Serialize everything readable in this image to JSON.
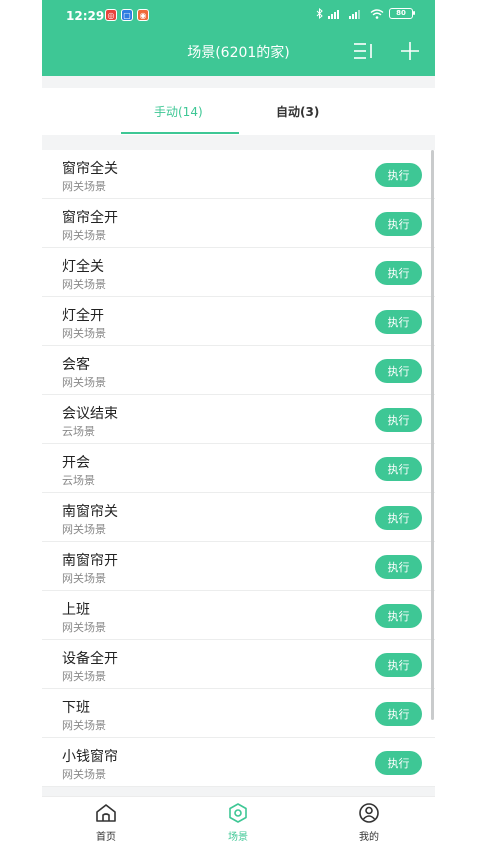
{
  "status_bar": {
    "time": "12:29",
    "battery": "80"
  },
  "header": {
    "title": "场景(6201的家)"
  },
  "tabs": [
    {
      "label": "手动(14)",
      "active": true
    },
    {
      "label": "自动(3)",
      "active": false
    }
  ],
  "scenes": [
    {
      "name": "窗帘全关",
      "type": "网关场景",
      "action": "执行"
    },
    {
      "name": "窗帘全开",
      "type": "网关场景",
      "action": "执行"
    },
    {
      "name": "灯全关",
      "type": "网关场景",
      "action": "执行"
    },
    {
      "name": "灯全开",
      "type": "网关场景",
      "action": "执行"
    },
    {
      "name": "会客",
      "type": "网关场景",
      "action": "执行"
    },
    {
      "name": "会议结束",
      "type": "云场景",
      "action": "执行"
    },
    {
      "name": "开会",
      "type": "云场景",
      "action": "执行"
    },
    {
      "name": "南窗帘关",
      "type": "网关场景",
      "action": "执行"
    },
    {
      "name": "南窗帘开",
      "type": "网关场景",
      "action": "执行"
    },
    {
      "name": "上班",
      "type": "网关场景",
      "action": "执行"
    },
    {
      "name": "设备全开",
      "type": "网关场景",
      "action": "执行"
    },
    {
      "name": "下班",
      "type": "网关场景",
      "action": "执行"
    },
    {
      "name": "小钱窗帘",
      "type": "网关场景",
      "action": "执行"
    }
  ],
  "bottom_nav": [
    {
      "label": "首页",
      "icon": "home-icon",
      "active": false
    },
    {
      "label": "场景",
      "icon": "scene-icon",
      "active": true
    },
    {
      "label": "我的",
      "icon": "profile-icon",
      "active": false
    }
  ],
  "colors": {
    "accent": "#3ec795",
    "background": "#f3f4f5"
  }
}
